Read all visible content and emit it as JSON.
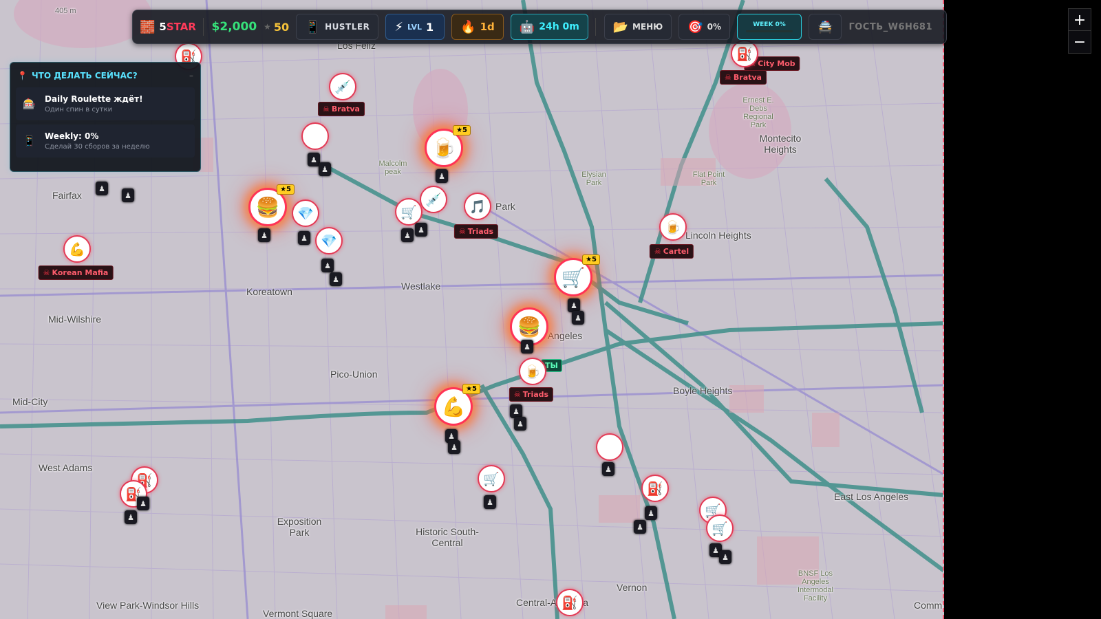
{
  "topbar": {
    "brand_num": "5",
    "brand_word": "STAR",
    "cash": "$2,000",
    "rep_value": "50",
    "rank": "HUSTLER",
    "level_label": "LVL",
    "level_value": "1",
    "streak": "1d",
    "timer": "24h 0m",
    "menu_label": "МЕНЮ",
    "target_pct": "0%",
    "week_label": "WEEK 0%",
    "week_progress": 0,
    "username": "ГОСТЬ_W6H681"
  },
  "zoom": {
    "in": "+",
    "out": "−"
  },
  "quest": {
    "title": "ЧТО ДЕЛАТЬ СЕЙЧАС?",
    "collapse": "–",
    "items": [
      {
        "title": "Daily Roulette ждёт!",
        "subtitle": "Один спин в сутки",
        "icon": "roulette-icon"
      },
      {
        "title": "Weekly: 0%",
        "subtitle": "Сделай 30 сборов за неделю",
        "icon": "phone-icon"
      }
    ]
  },
  "map": {
    "labels": [
      "Los Feliz",
      "Fairfax",
      "Koreatown",
      "Mid-Wilshire",
      "Westlake",
      "Pico-Union",
      "Mid-City",
      "West Adams",
      "Exposition Park",
      "Historic South-Central",
      "View Park-Windsor Hills",
      "Vermont Square",
      "Central-Alameda",
      "Vernon",
      "Boyle Heights",
      "East Los Angeles",
      "Montecito Heights",
      "Lincoln Heights",
      "Park",
      "Flat Point Park",
      "Elysian Park",
      "Malcolm peak",
      "Ernest E. Debs Regional Park",
      "BNSF Los Angeles Intermodal Facility",
      "405 m",
      "Los Angeles",
      "Commerce"
    ],
    "gangs": [
      "City Mob",
      "Bratva",
      "Bratva",
      "Triads",
      "Cartel",
      "Korean Mafia",
      "Triads"
    ],
    "star_badge": "★5",
    "pin_glyph": "♟",
    "tag_label": "ТЫ"
  }
}
